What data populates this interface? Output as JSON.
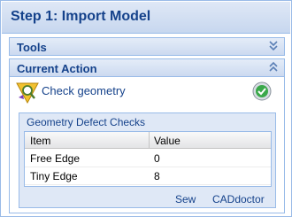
{
  "step": {
    "title": "Step 1: Import Model"
  },
  "panels": {
    "tools": {
      "label": "Tools",
      "state": "collapsed"
    },
    "current_action": {
      "label": "Current Action",
      "state": "expanded"
    }
  },
  "action": {
    "label": "Check geometry",
    "icon": "magnifier-warning-icon",
    "status_icon": "check-circle-icon"
  },
  "defects": {
    "title": "Geometry Defect Checks",
    "columns": [
      "Item",
      "Value"
    ],
    "rows": [
      {
        "item": "Free Edge",
        "value": "0"
      },
      {
        "item": "Tiny Edge",
        "value": "8"
      }
    ],
    "actions": {
      "sew": "Sew",
      "caddoctor": "CADdoctor"
    }
  },
  "colors": {
    "accent": "#15428b",
    "border": "#99bbe8",
    "panel_bg": "#dfe8f6",
    "success": "#3aa84a"
  }
}
